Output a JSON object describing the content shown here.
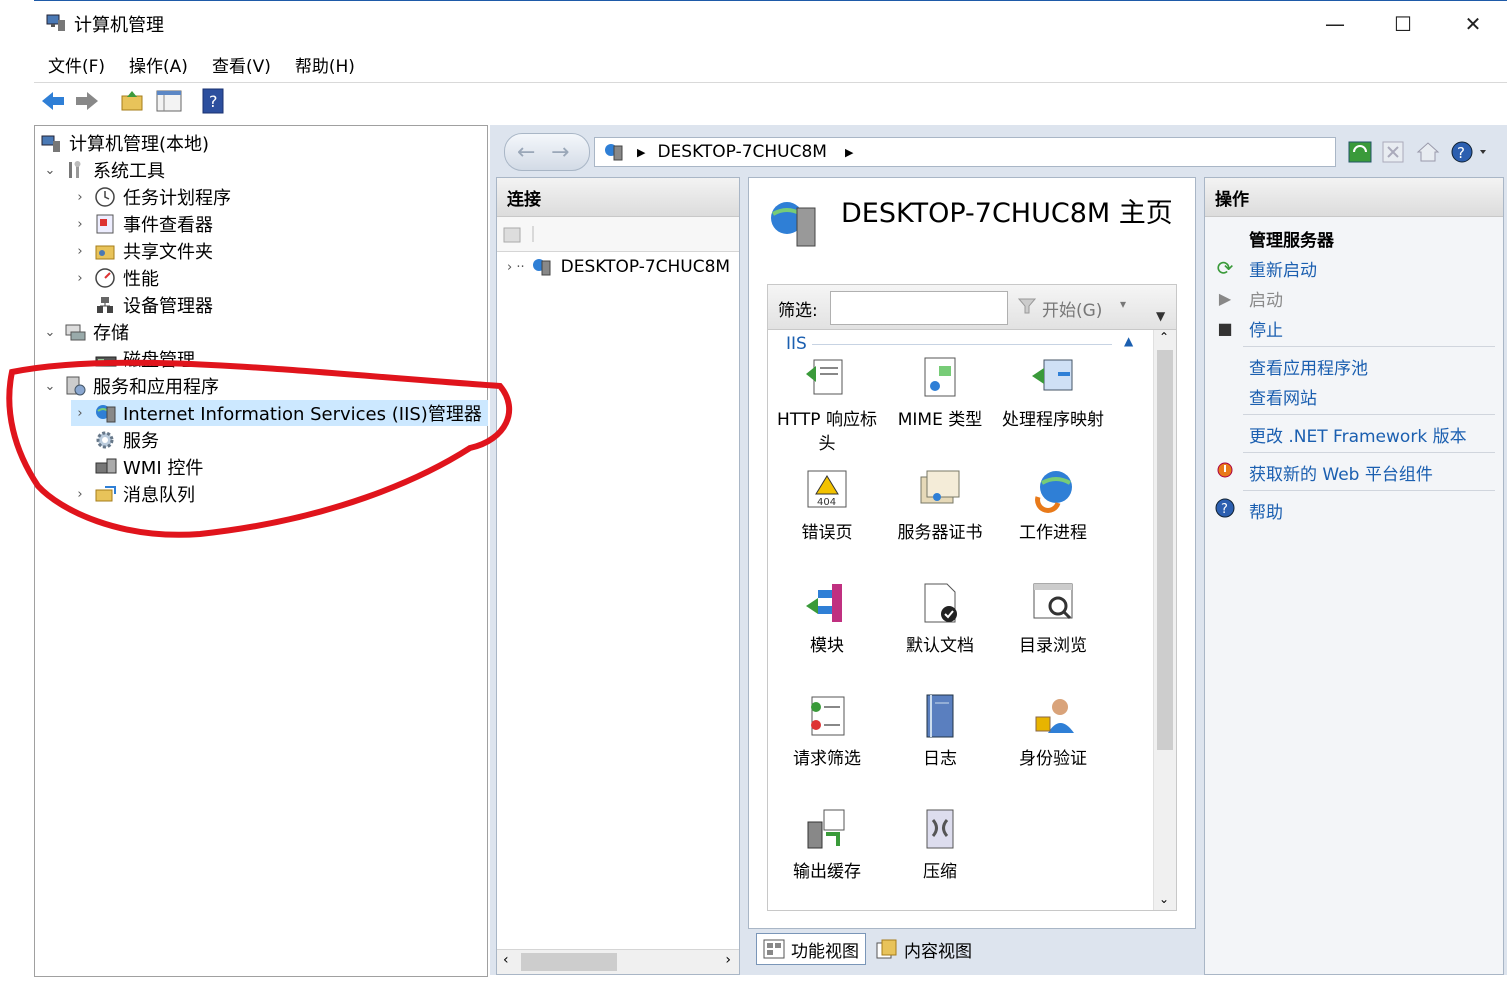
{
  "window": {
    "title": "计算机管理",
    "minimize_icon": "minimize-icon",
    "maximize_icon": "maximize-icon",
    "close_icon": "close-icon"
  },
  "menu": [
    "文件(F)",
    "操作(A)",
    "查看(V)",
    "帮助(H)"
  ],
  "tree": {
    "root": "计算机管理(本地)",
    "system_tools": "系统工具",
    "task_scheduler": "任务计划程序",
    "event_viewer": "事件查看器",
    "shared_folders": "共享文件夹",
    "performance": "性能",
    "device_manager": "设备管理器",
    "storage": "存储",
    "disk_management": "磁盘管理",
    "services_apps": "服务和应用程序",
    "iis_manager": "Internet Information Services (IIS)管理器",
    "services": "服务",
    "wmi": "WMI 控件",
    "message_queue": "消息队列"
  },
  "iis": {
    "address": "DESKTOP-7CHUC8M",
    "connections_header": "连接",
    "connections_node": "DESKTOP-7CHUC8M",
    "home_title": "DESKTOP-7CHUC8M 主页",
    "filter_label": "筛选:",
    "start_label": "开始(G)",
    "group_label": "IIS",
    "features": [
      "HTTP 响应标头",
      "MIME 类型",
      "处理程序映射",
      "错误页",
      "服务器证书",
      "工作进程",
      "模块",
      "默认文档",
      "目录浏览",
      "请求筛选",
      "日志",
      "身份验证",
      "输出缓存",
      "压缩"
    ],
    "tab_features": "功能视图",
    "tab_content": "内容视图",
    "actions_header": "操作",
    "manage_server": "管理服务器",
    "restart": "重新启动",
    "start": "启动",
    "stop": "停止",
    "view_app_pools": "查看应用程序池",
    "view_sites": "查看网站",
    "change_net": "更改 .NET Framework 版本",
    "get_web_components": "获取新的 Web 平台组件",
    "help": "帮助"
  },
  "colors": {
    "accent": "#1b5fb0",
    "annotation": "#e0141c",
    "selection": "#cce8ff"
  }
}
